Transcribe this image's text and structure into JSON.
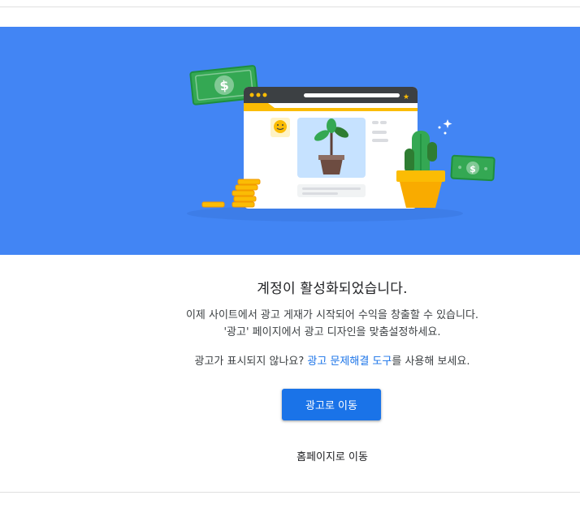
{
  "hero": {
    "illustration": "adsense-activated-illustration",
    "background_color": "#4285f4"
  },
  "main": {
    "title": "계정이 활성화되었습니다.",
    "description_line1": "이제 사이트에서 광고 게재가 시작되어 수익을 창출할 수 있습니다.",
    "description_line2": "'광고' 페이지에서 광고 디자인을 맞춤설정하세요.",
    "help_prefix": "광고가 표시되지 않나요? ",
    "help_link": "광고 문제해결 도구",
    "help_suffix": "를 사용해 보세요.",
    "primary_button": "광고로 이동",
    "secondary_button": "홈페이지로 이동",
    "accent_color": "#1a73e8"
  }
}
